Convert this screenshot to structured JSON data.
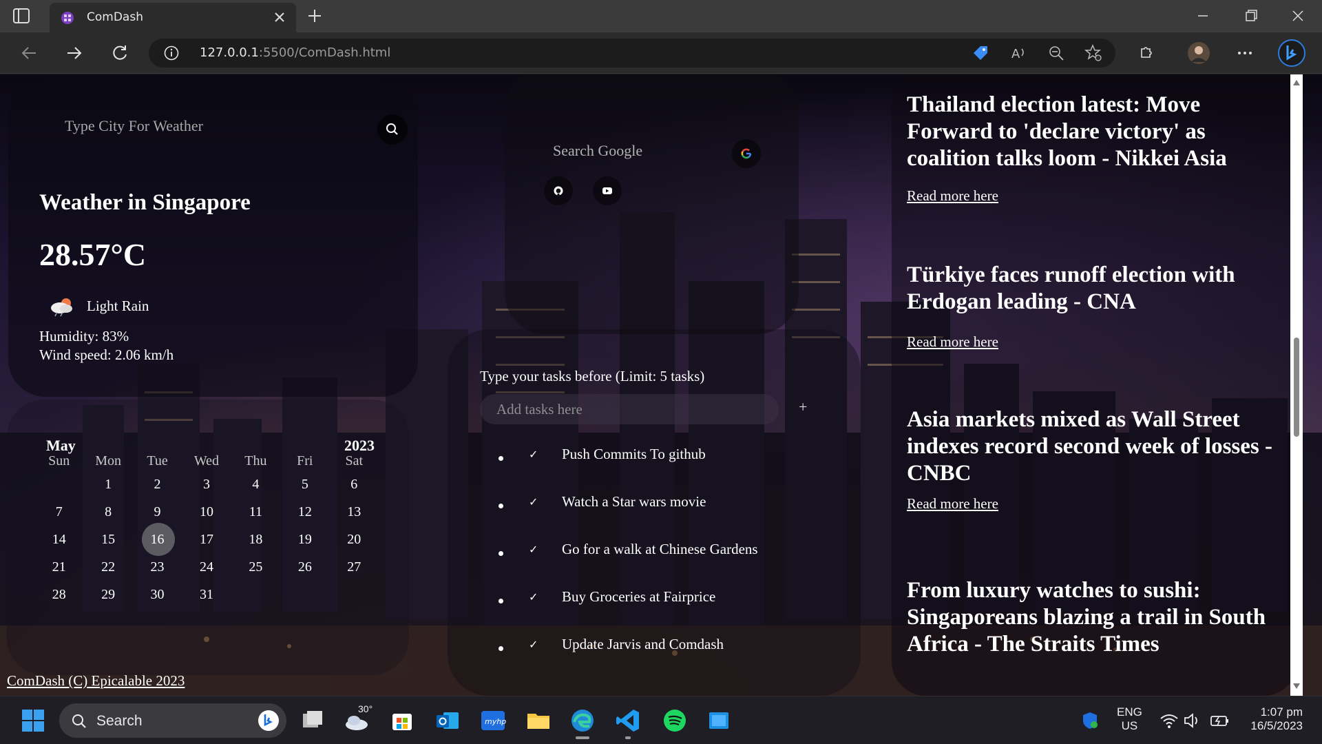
{
  "browser": {
    "tab_title": "ComDash",
    "url_host": "127.0.0.1",
    "url_rest": ":5500/ComDash.html"
  },
  "weather": {
    "search_placeholder": "Type City For Weather",
    "title": "Weather in Singapore",
    "temperature": "28.57°C",
    "description": "Light Rain",
    "humidity": "Humidity: 83%",
    "wind": "Wind speed: 2.06 km/h",
    "icon": "cloud-rain-icon"
  },
  "calendar": {
    "month": "May",
    "year": "2023",
    "weekdays": [
      "Sun",
      "Mon",
      "Tue",
      "Wed",
      "Thu",
      "Fri",
      "Sat"
    ],
    "weeks": [
      [
        "",
        "1",
        "2",
        "3",
        "4",
        "5",
        "6"
      ],
      [
        "7",
        "8",
        "9",
        "10",
        "11",
        "12",
        "13"
      ],
      [
        "14",
        "15",
        "16",
        "17",
        "18",
        "19",
        "20"
      ],
      [
        "21",
        "22",
        "23",
        "24",
        "25",
        "26",
        "27"
      ],
      [
        "28",
        "29",
        "30",
        "31",
        "",
        "",
        ""
      ]
    ],
    "today": "16"
  },
  "google": {
    "search_placeholder": "Search Google",
    "links": [
      "github-icon",
      "youtube-icon"
    ]
  },
  "tasks": {
    "heading": "Type your tasks before (Limit: 5 tasks)",
    "input_placeholder": "Add tasks here",
    "add_symbol": "+",
    "items": [
      "Push Commits To github",
      "Watch a Star wars movie",
      "Go for a walk at Chinese Gardens",
      "Buy Groceries at Fairprice",
      "Update Jarvis and Comdash"
    ],
    "check_symbol": "✓"
  },
  "news": {
    "items": [
      {
        "title": "Thailand election latest: Move Forward to 'declare victory' as coalition talks loom - Nikkei Asia",
        "link": "Read more here"
      },
      {
        "title": "Türkiye faces runoff election with Erdogan leading - CNA",
        "link": "Read more here"
      },
      {
        "title": "Asia markets mixed as Wall Street indexes record second week of losses - CNBC",
        "link": "Read more here"
      },
      {
        "title": "From luxury watches to sushi: Singaporeans blazing a trail in South Africa - The Straits Times",
        "link": ""
      }
    ]
  },
  "footer": "ComDash (C) Epicalable 2023",
  "taskbar": {
    "search_label": "Search",
    "weather_temp": "30°",
    "lang": "ENG",
    "region": "US",
    "time": "1:07 pm",
    "date": "16/5/2023"
  }
}
